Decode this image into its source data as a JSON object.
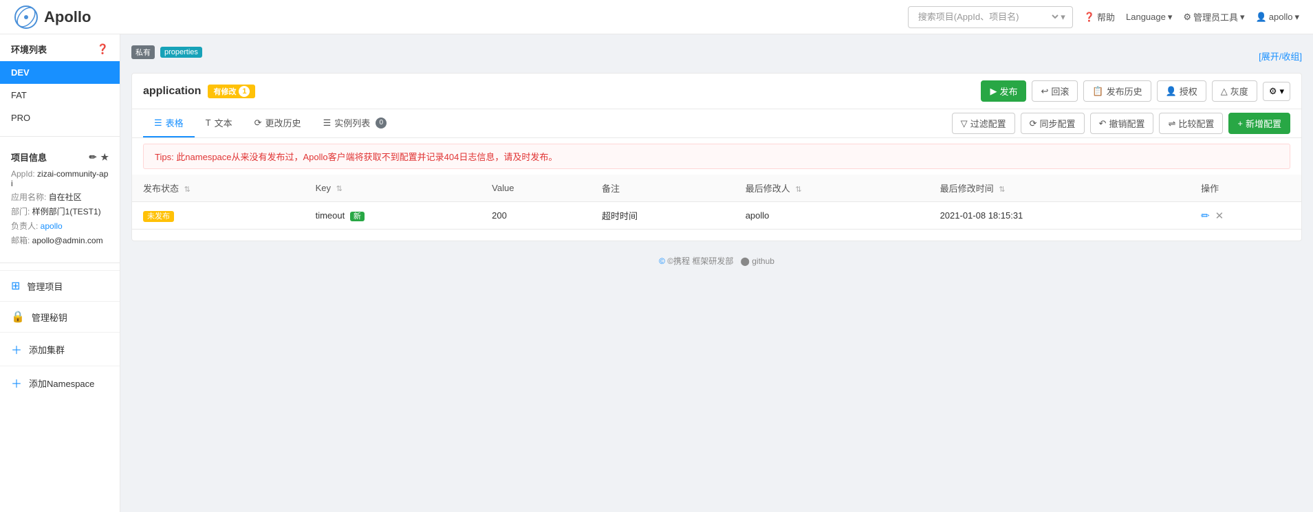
{
  "header": {
    "logo_text": "Apollo",
    "search_placeholder": "搜索项目(AppId、项目名)",
    "help_label": "帮助",
    "language_label": "Language",
    "language_icon": "▾",
    "admin_tools_label": "管理员工具",
    "admin_tools_icon": "▾",
    "user_label": "apollo",
    "user_icon": "▾"
  },
  "sidebar": {
    "env_list_label": "环境列表",
    "envs": [
      {
        "name": "DEV",
        "active": true
      },
      {
        "name": "FAT",
        "active": false
      },
      {
        "name": "PRO",
        "active": false
      }
    ],
    "project_info_label": "项目信息",
    "project_fields": [
      {
        "label": "AppId:",
        "value": "zizai-community-api"
      },
      {
        "label": "应用名称:",
        "value": "自在社区"
      },
      {
        "label": "部门:",
        "value": "样例部门1(TEST1)"
      },
      {
        "label": "负责人:",
        "value": "apollo"
      },
      {
        "label": "邮箱:",
        "value": "apollo@admin.com"
      }
    ],
    "menu_items": [
      {
        "icon": "⊞",
        "label": "管理项目",
        "name": "manage-project"
      },
      {
        "icon": "🔒",
        "label": "管理秘钥",
        "name": "manage-secret"
      },
      {
        "icon": "+",
        "label": "添加集群",
        "name": "add-cluster"
      },
      {
        "icon": "+",
        "label": "添加Namespace",
        "name": "add-namespace"
      }
    ]
  },
  "namespace_header": {
    "badge_private": "私有",
    "badge_properties": "properties",
    "expand_collapse": "[展开/收组]"
  },
  "app_block": {
    "title": "application",
    "modified_badge": "有修改",
    "modified_count": "1",
    "actions": {
      "publish": "发布",
      "rollback": "回滚",
      "publish_history": "发布历史",
      "authorize": "授权",
      "grayscale": "灰度",
      "gear": "⚙"
    }
  },
  "tabs": [
    {
      "icon": "☰",
      "label": "表格",
      "active": true
    },
    {
      "icon": "T",
      "label": "文本",
      "active": false
    },
    {
      "icon": "⟳",
      "label": "更改历史",
      "active": false
    },
    {
      "icon": "☰",
      "label": "实例列表",
      "active": false,
      "badge": "0"
    }
  ],
  "tab_actions": {
    "filter": "过滤配置",
    "sync": "同步配置",
    "revoke": "撤销配置",
    "compare": "比较配置",
    "add": "新增配置"
  },
  "tips": "Tips: 此namespace从来没有发布过，Apollo客户端将获取不到配置并记录404日志信息，请及时发布。",
  "table": {
    "columns": [
      "发布状态",
      "Key",
      "Value",
      "备注",
      "最后修改人",
      "最后修改时间",
      "操作"
    ],
    "rows": [
      {
        "status": "未发布",
        "key": "timeout",
        "is_new": true,
        "value": "200",
        "remark": "超时时间",
        "modifier": "apollo",
        "modified_time": "2021-01-08 18:15:31"
      }
    ]
  },
  "footer": {
    "copyright": "©携程 框架研发部",
    "github": "github"
  }
}
